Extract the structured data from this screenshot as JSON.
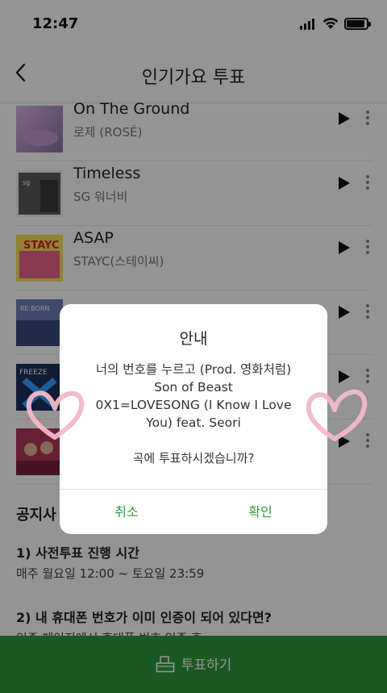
{
  "status": {
    "time": "12:47"
  },
  "header": {
    "title": "인기가요 투표"
  },
  "songs": [
    {
      "title": "On The Ground",
      "artist": "로제 (ROSÉ)"
    },
    {
      "title": "Timeless",
      "artist": "SG 워너비"
    },
    {
      "title": "ASAP",
      "artist": "STAYC(스테이씨)"
    },
    {
      "title": "",
      "artist": ""
    },
    {
      "title": "",
      "artist": ""
    },
    {
      "title": "",
      "artist": ""
    }
  ],
  "notice": {
    "title": "공지사",
    "items": [
      {
        "title": "1) 사전투표 진행 시간",
        "text": "매주 월요일 12:00 ~ 토요일 23:59"
      },
      {
        "title": "2) 내 휴대폰 번호가 이미 인증이 되어 있다면?",
        "text": "인증 페이지에서 휴대폰 번호 인증 후"
      }
    ]
  },
  "vote_button": {
    "label": "투표하기"
  },
  "dialog": {
    "title": "안내",
    "line1": "너의 번호를 누르고 (Prod. 영화처럼)",
    "line2": "Son of Beast",
    "line3": "0X1=LOVESONG (I Know I Love",
    "line4": "You) feat. Seori",
    "question": "곡에 투표하시겠습니까?",
    "cancel": "취소",
    "confirm": "확인"
  },
  "colors": {
    "accent": "#2f9a3d",
    "heart": "#f2b8c8"
  },
  "icons": [
    "back-chevron-icon",
    "play-icon",
    "more-vertical-icon",
    "ballot-box-icon",
    "heart-sticker-icon",
    "signal-icon",
    "wifi-icon",
    "battery-icon"
  ]
}
